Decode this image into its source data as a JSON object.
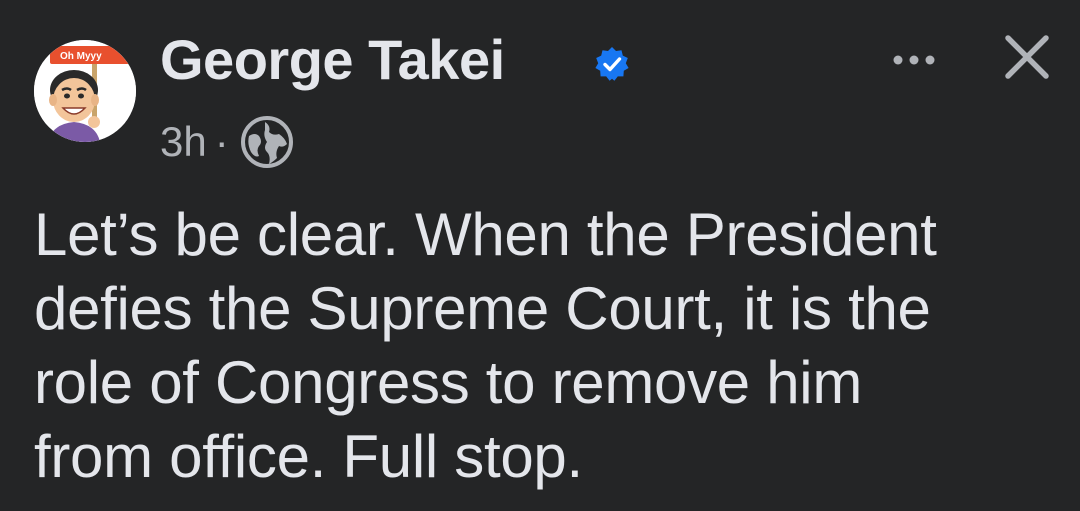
{
  "author": {
    "name": "George Takei",
    "verified": true,
    "avatar_icon": "cartoon-avatar-with-sign",
    "avatar_sign_text": "Oh Myyy"
  },
  "meta": {
    "timestamp": "3h",
    "separator": "·",
    "audience_icon": "globe-icon"
  },
  "actions": {
    "more_icon": "more-options-icon",
    "close_icon": "close-icon"
  },
  "post": {
    "lines": [
      "Let’s be clear. When the President",
      "defies the Supreme Court, it is the",
      "role of Congress to remove him",
      "from office. Full stop."
    ]
  },
  "colors": {
    "background": "#242526",
    "primary_text": "#e4e6eb",
    "secondary_text": "#b0b3b8",
    "verified_badge": "#1877f2"
  }
}
